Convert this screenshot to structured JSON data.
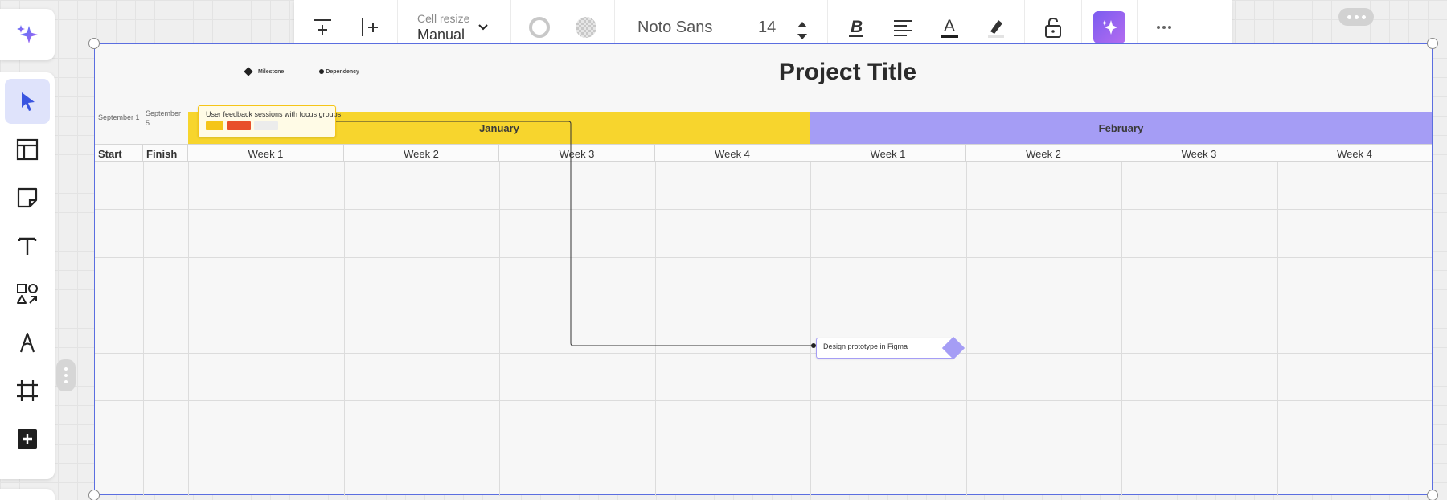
{
  "left_panel": {
    "ai_icon": "sparkle-icon",
    "tools": [
      {
        "name": "select-tool",
        "icon": "cursor-icon",
        "active": true
      },
      {
        "name": "templates-tool",
        "icon": "layout-icon"
      },
      {
        "name": "sticky-note-tool",
        "icon": "sticky-note-icon"
      },
      {
        "name": "text-tool",
        "icon": "text-icon"
      },
      {
        "name": "shapes-tool",
        "icon": "shapes-icon"
      },
      {
        "name": "pen-tool",
        "icon": "pen-icon"
      },
      {
        "name": "frame-tool",
        "icon": "frame-icon"
      },
      {
        "name": "add-tool",
        "icon": "plus-square-icon"
      }
    ]
  },
  "toolbar": {
    "cell_resize_label": "Cell resize",
    "cell_resize_value": "Manual",
    "font_name": "Noto Sans",
    "font_size": "14",
    "bold_letter": "B",
    "text_color_letter": "A"
  },
  "gantt": {
    "title": "Project Title",
    "legend": {
      "milestone": "Milestone",
      "dependency": "Dependency"
    },
    "months": [
      {
        "label": "January",
        "color": "#f7d52d"
      },
      {
        "label": "February",
        "color": "#a59df5"
      }
    ],
    "columns": {
      "start": "Start",
      "finish": "Finish"
    },
    "weeks": [
      "Week 1",
      "Week 2",
      "Week 3",
      "Week 4",
      "Week 1",
      "Week 2",
      "Week 3",
      "Week 4"
    ],
    "rows": [
      {
        "start": "September 1",
        "finish": "September 5"
      }
    ],
    "task": {
      "title": "User feedback sessions with focus groups",
      "border_color": "#f5c518",
      "chips": [
        "#f5c518",
        "#e8502a",
        "#ececec"
      ]
    },
    "milestone": {
      "title": "Design prototype in Figma",
      "color": "#a59df5"
    }
  },
  "colors": {
    "selection": "#5b6ee0",
    "accent": "#7b5cf0"
  }
}
